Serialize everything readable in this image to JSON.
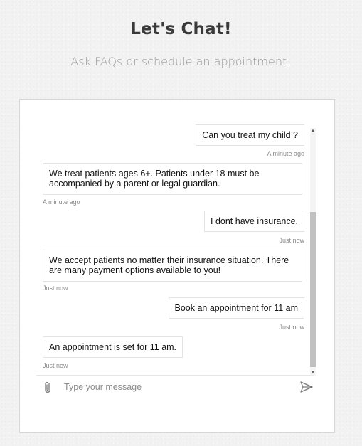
{
  "header": {
    "title": "Let's Chat!",
    "subtitle": "Ask FAQs or schedule an appointment!"
  },
  "chat": {
    "messages": [
      {
        "sender": "user",
        "text": "Can you treat my child ?",
        "time": "A minute ago"
      },
      {
        "sender": "bot",
        "text": "We treat patients ages 6+. Patients under 18 must be accompanied by a parent or legal guardian.",
        "time": "A minute ago"
      },
      {
        "sender": "user",
        "text": "I dont have insurance.",
        "time": "Just now"
      },
      {
        "sender": "bot",
        "text": "We accept patients no matter their insurance situation. There are many payment options available to you!",
        "time": "Just now"
      },
      {
        "sender": "user",
        "text": "Book an appointment for 11 am",
        "time": "Just now"
      },
      {
        "sender": "bot",
        "text": "An appointment is set for 11 am.",
        "time": "Just now"
      }
    ]
  },
  "composer": {
    "placeholder": "Type your message",
    "attach_icon": "paperclip-icon",
    "send_icon": "send-icon"
  },
  "scrollbar": {
    "up_icon": "▲",
    "down_icon": "▼"
  }
}
